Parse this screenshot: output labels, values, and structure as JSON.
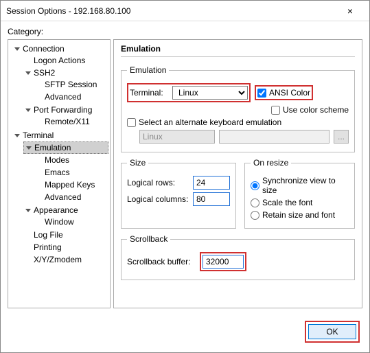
{
  "window": {
    "title": "Session Options - 192.168.80.100",
    "close": "×"
  },
  "category_label": "Category:",
  "tree": {
    "connection": "Connection",
    "logon": "Logon Actions",
    "ssh2": "SSH2",
    "sftp": "SFTP Session",
    "ssh2_adv": "Advanced",
    "portfwd": "Port Forwarding",
    "remote": "Remote/X11",
    "terminal": "Terminal",
    "emulation": "Emulation",
    "modes": "Modes",
    "emacs": "Emacs",
    "mapped": "Mapped Keys",
    "term_adv": "Advanced",
    "appearance": "Appearance",
    "window": "Window",
    "logfile": "Log File",
    "printing": "Printing",
    "xyz": "X/Y/Zmodem"
  },
  "panel": {
    "heading": "Emulation",
    "emu_group": "Emulation",
    "terminal_label": "Terminal:",
    "terminal_value": "Linux",
    "ansi": "ANSI Color",
    "colorscheme": "Use color scheme",
    "altkbd": "Select an alternate keyboard emulation",
    "altkbd_val": "Linux",
    "browse": "...",
    "size_group": "Size",
    "rows_label": "Logical rows:",
    "rows_val": "24",
    "cols_label": "Logical columns:",
    "cols_val": "80",
    "resize_group": "On resize",
    "resize_sync": "Synchronize view to size",
    "resize_scale": "Scale the font",
    "resize_retain": "Retain size and font",
    "scroll_group": "Scrollback",
    "scroll_label": "Scrollback buffer:",
    "scroll_val": "32000"
  },
  "footer": {
    "ok": "OK"
  }
}
